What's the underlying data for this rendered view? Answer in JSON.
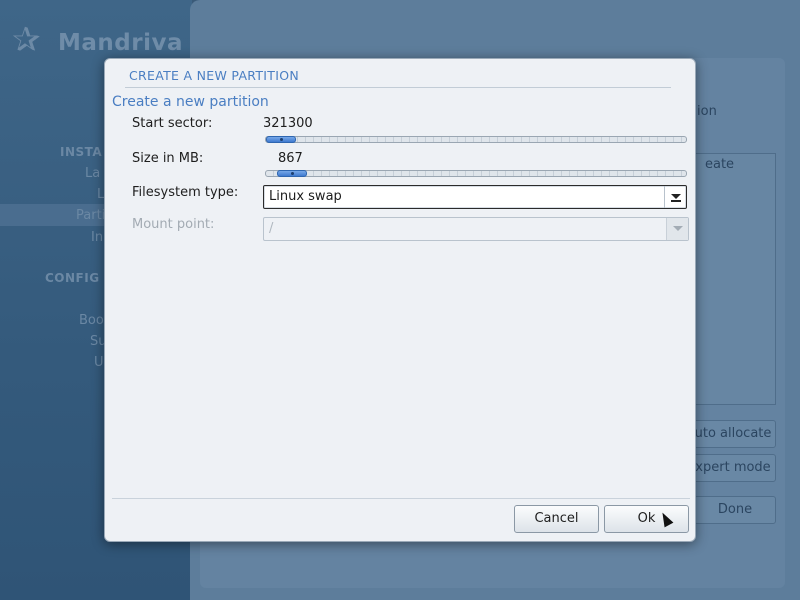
{
  "background": {
    "logo_text": "Mandriva",
    "left_menu": [
      {
        "label": "INSTA",
        "kind": "head"
      },
      {
        "label": "La",
        "kind": "item"
      },
      {
        "label": "L",
        "kind": "item"
      },
      {
        "label": "Parti",
        "kind": "selected"
      },
      {
        "label": "In",
        "kind": "item"
      },
      {
        "label": "CONFIG",
        "kind": "head"
      },
      {
        "label": "Boo",
        "kind": "item"
      },
      {
        "label": "Su",
        "kind": "item"
      },
      {
        "label": "U",
        "kind": "item"
      }
    ],
    "right_fragments": {
      "ion": "ion",
      "eate": "eate",
      "auto_allocate": "uto allocate",
      "expert_mode": "xpert mode",
      "done": "Done"
    }
  },
  "dialog": {
    "title": "CREATE A NEW PARTITION",
    "subtitle": "Create a new partition",
    "start_sector": {
      "label": "Start sector:",
      "value": "321300",
      "slider_fraction": 0.07
    },
    "size_mb": {
      "label": "Size in MB:",
      "value": "867",
      "slider_fraction": 0.07
    },
    "filesystem_type": {
      "label": "Filesystem type:",
      "value": "Linux swap"
    },
    "mount_point": {
      "label": "Mount point:",
      "value": "/"
    },
    "buttons": {
      "cancel": "Cancel",
      "ok": "Ok"
    }
  },
  "colors": {
    "accent": "#4a7ec2",
    "dialog_bg": "#eef1f5",
    "slider_fill": "#3f7ad0"
  }
}
